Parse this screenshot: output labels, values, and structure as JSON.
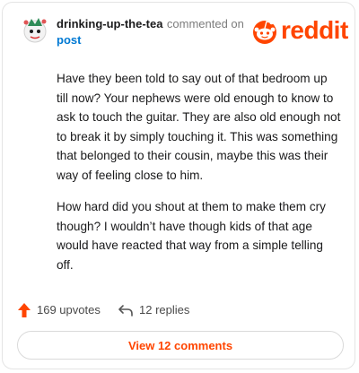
{
  "comment": {
    "username": "drinking-up-the-tea",
    "commented_text": "commented on",
    "post_link": "post",
    "paragraphs": [
      "Have they been told to say out of that bedroom up till now? Your nephews were old enough to know to ask to touch the guitar. They are also old enough not to break it by simply touching it. This was something that belonged to their cousin, maybe this was their way of feeling close to him.",
      "How hard did you shout at them to make them cry though? I wouldn’t have though kids of that age would have reacted that way from a simple telling off."
    ]
  },
  "branding": {
    "logo_text": "reddit",
    "brand_color": "#ff4500"
  },
  "actions": {
    "upvotes": "169 upvotes",
    "replies": "12 replies",
    "view_comments": "View 12 comments"
  },
  "icons": [
    "avatar",
    "reddit-logo-icon",
    "upvote-arrow-icon",
    "reply-arrow-icon"
  ]
}
